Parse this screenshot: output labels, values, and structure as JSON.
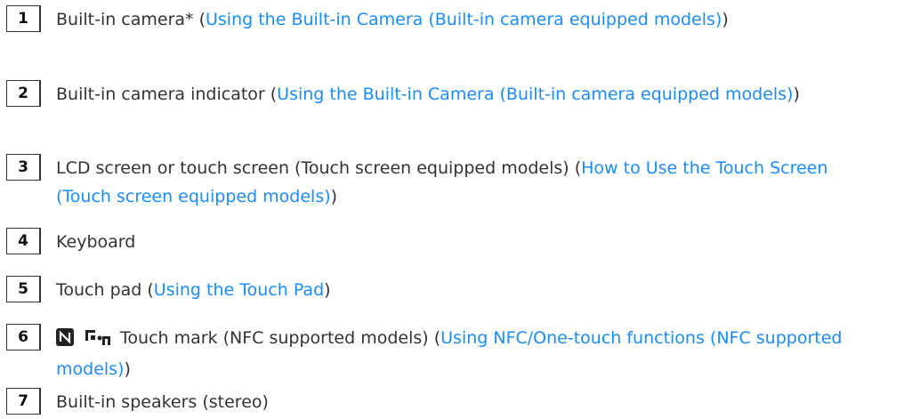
{
  "items": [
    {
      "number": "1",
      "prefix": "Built-in camera* (",
      "link": "Using the Built-in Camera (Built-in camera equipped models)",
      "suffix": ")"
    },
    {
      "number": "2",
      "prefix": "Built-in camera indicator (",
      "link": "Using the Built-in Camera (Built-in camera equipped models)",
      "suffix": ")"
    },
    {
      "number": "3",
      "prefix": "LCD screen or touch screen (Touch screen equipped models) (",
      "link": "How to Use the Touch Screen (Touch screen equipped models)",
      "suffix": ")"
    },
    {
      "number": "4",
      "prefix": "Keyboard"
    },
    {
      "number": "5",
      "prefix": "Touch pad (",
      "link": "Using the Touch Pad",
      "suffix": ")"
    },
    {
      "number": "6",
      "icons": [
        "nfc-n-mark-icon",
        "one-touch-icon"
      ],
      "prefix": " Touch mark (NFC supported models) (",
      "link": "Using NFC/One-touch functions (NFC supported models)",
      "suffix": ")"
    },
    {
      "number": "7",
      "prefix": "Built-in speakers (stereo)"
    }
  ],
  "colors": {
    "text": "#333333",
    "link": "#1a8cff",
    "border": "#333333"
  }
}
